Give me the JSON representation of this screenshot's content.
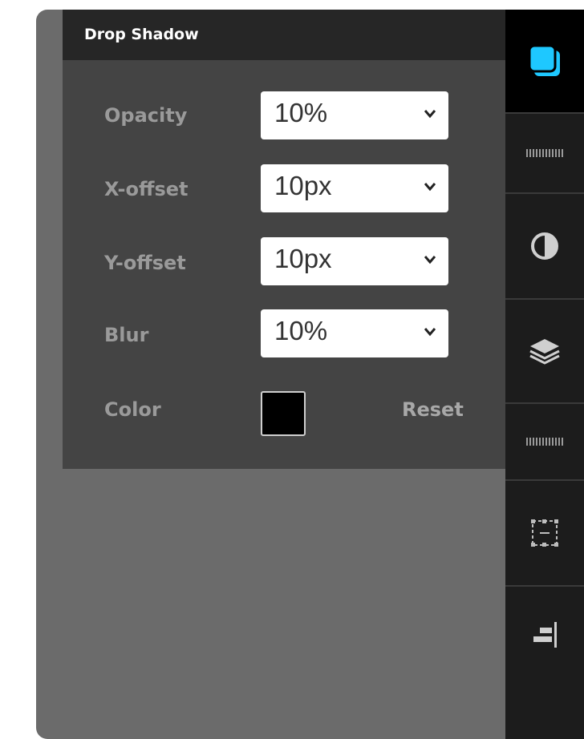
{
  "panel": {
    "title": "Drop Shadow",
    "rows": [
      {
        "label": "Opacity",
        "value": "10%"
      },
      {
        "label": "X-offset",
        "value": "10px"
      },
      {
        "label": "Y-offset",
        "value": "10px"
      },
      {
        "label": "Blur",
        "value": "10%"
      }
    ],
    "color_label": "Color",
    "color_value": "#000000",
    "reset_label": "Reset"
  },
  "toolbar": {
    "items": [
      {
        "name": "drop-shadow-icon",
        "active": true,
        "accent": "#1ec8ff"
      },
      {
        "name": "ruler-tick-icon",
        "active": false
      },
      {
        "name": "contrast-icon",
        "active": false
      },
      {
        "name": "layers-icon",
        "active": false
      },
      {
        "name": "ruler-tick-icon",
        "active": false
      },
      {
        "name": "selection-box-icon",
        "active": false
      },
      {
        "name": "align-right-icon",
        "active": false
      }
    ]
  }
}
